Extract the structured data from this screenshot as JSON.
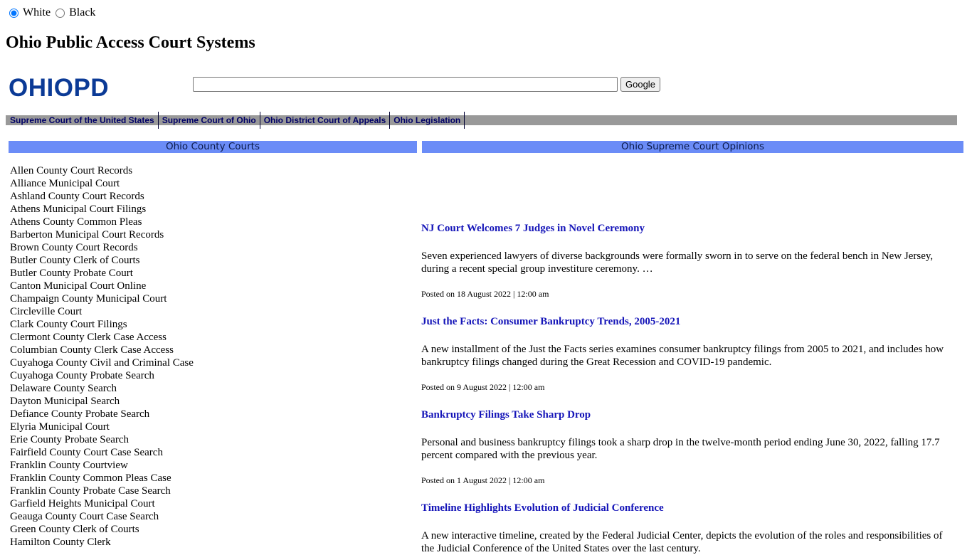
{
  "theme": {
    "options": [
      {
        "label": "White",
        "checked": true
      },
      {
        "label": "Black",
        "checked": false
      }
    ]
  },
  "page_title": "Ohio Public Access Court Systems",
  "logo": "OHIOPD",
  "search": {
    "placeholder": "",
    "value": "",
    "button_label": "Google"
  },
  "nav": {
    "items": [
      "Supreme Court of the United States",
      "Supreme Court of Ohio",
      "Ohio District Court of Appeals",
      "Ohio Legislation"
    ]
  },
  "left_column": {
    "header": "Ohio County Courts",
    "items": [
      "Allen County Court Records",
      "Alliance Municipal Court",
      "Ashland County Court Records",
      "Athens Municipal Court Filings",
      "Athens County Common Pleas",
      "Barberton Municipal Court Records",
      "Brown County Court Records",
      "Butler County Clerk of Courts",
      "Butler County Probate Court",
      "Canton Municipal Court Online",
      "Champaign County Municipal Court",
      "Circleville Court",
      "Clark County Court Filings",
      "Clermont County Clerk Case Access",
      "Columbian County Clerk Case Access",
      "Cuyahoga County Civil and Criminal Case",
      "Cuyahoga County Probate Search",
      "Delaware County Search",
      "Dayton Municipal Search",
      "Defiance County Probate Search",
      "Elyria Municipal Court",
      "Erie County Probate Search",
      "Fairfield County Court Case Search",
      "Franklin County Courtview",
      "Franklin County Common Pleas Case",
      "Franklin County Probate Case Search",
      "Garfield Heights Municipal Court",
      "Geauga County Court Case Search",
      "Green County Clerk of Courts",
      "Hamilton County Clerk"
    ]
  },
  "right_column": {
    "header": "Ohio Supreme Court Opinions",
    "articles": [
      {
        "title": "NJ Court Welcomes 7 Judges in Novel Ceremony",
        "body": "Seven experienced lawyers of diverse backgrounds were formally sworn in to serve on the federal bench in New Jersey, during a recent special group investiture ceremony. …",
        "meta": "Posted on 18 August 2022 | 12:00 am"
      },
      {
        "title": "Just the Facts: Consumer Bankruptcy Trends, 2005-2021",
        "body": "A new installment of the Just the Facts series examines consumer bankruptcy filings from 2005 to 2021, and includes how bankruptcy filings changed during the Great Recession and COVID-19 pandemic.",
        "meta": "Posted on 9 August 2022 | 12:00 am"
      },
      {
        "title": "Bankruptcy Filings Take Sharp Drop",
        "body": "Personal and business bankruptcy filings took a sharp drop in the twelve-month period ending June 30, 2022, falling 17.7 percent compared with the previous year.",
        "meta": "Posted on 1 August 2022 | 12:00 am"
      },
      {
        "title": "Timeline Highlights Evolution of Judicial Conference",
        "body": "A new interactive timeline, created by the Federal Judicial Center, depicts the evolution of the roles and responsibilities of the Judicial Conference of the United States over the last century.",
        "meta": ""
      }
    ]
  },
  "colors": {
    "logo": "#0b3a96",
    "nav_bg": "#999999",
    "nav_text": "#000066",
    "column_header_bg": "#6b8cf7",
    "article_title": "#1414b8"
  }
}
